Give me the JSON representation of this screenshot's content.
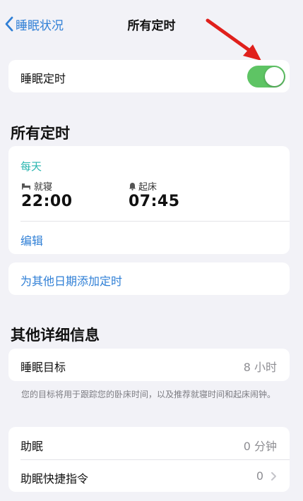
{
  "nav": {
    "back_label": "睡眠状况",
    "title": "所有定时"
  },
  "sleep_schedule": {
    "label": "睡眠定时",
    "enabled": true
  },
  "all_schedules": {
    "section_title": "所有定时",
    "days": "每天",
    "bedtime_label": "就寝",
    "bedtime": "22:00",
    "wake_label": "起床",
    "wake_time": "07:45",
    "edit_label": "编辑",
    "add_label": "为其他日期添加定时"
  },
  "details": {
    "section_title": "其他详细信息",
    "goal_label": "睡眠目标",
    "goal_value": "8 小时",
    "goal_footnote": "您的目标将用于跟踪您的卧床时间，以及推荐就寝时间和起床闹钟。",
    "wind_down_label": "助眠",
    "wind_down_value": "0 分钟",
    "shortcuts_label": "助眠快捷指令",
    "shortcuts_value": "0"
  },
  "annotation": {
    "arrow_color": "#e0201c"
  },
  "colors": {
    "accent": "#2f7fd6",
    "teal": "#2bb6b0",
    "toggle_on": "#5ec464",
    "background": "#f2f2f7"
  },
  "icons": {
    "back": "chevron-left-icon",
    "bed": "bed-icon",
    "alarm": "bell-icon",
    "disclosure": "chevron-right-icon"
  }
}
